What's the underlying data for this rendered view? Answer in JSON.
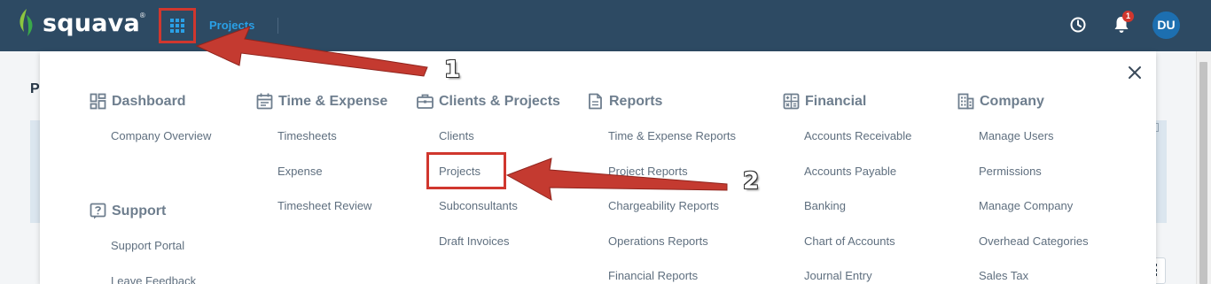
{
  "header": {
    "logo_text": "squava",
    "logo_tm": "®",
    "nav_projects": "Projects",
    "notification_count": "1",
    "avatar_initials": "DU"
  },
  "background": {
    "page_title_initial": "P"
  },
  "menu": {
    "columns": [
      {
        "heading": "Dashboard",
        "icon": "dashboard-icon",
        "items": [
          "Company Overview"
        ]
      },
      {
        "heading": "Time & Expense",
        "icon": "calendar-icon",
        "items": [
          "Timesheets",
          "Expense",
          "Timesheet Review"
        ]
      },
      {
        "heading": "Clients & Projects",
        "icon": "briefcase-icon",
        "items": [
          "Clients",
          "Projects",
          "Subconsultants",
          "Draft Invoices"
        ]
      },
      {
        "heading": "Reports",
        "icon": "report-icon",
        "items": [
          "Time & Expense Reports",
          "Project Reports",
          "Chargeability Reports",
          "Operations Reports",
          "Financial Reports"
        ]
      },
      {
        "heading": "Financial",
        "icon": "calculator-icon",
        "items": [
          "Accounts Receivable",
          "Accounts Payable",
          "Banking",
          "Chart of Accounts",
          "Journal Entry"
        ]
      },
      {
        "heading": "Company",
        "icon": "building-icon",
        "items": [
          "Manage Users",
          "Permissions",
          "Manage Company",
          "Overhead Categories",
          "Sales Tax"
        ]
      }
    ],
    "support": {
      "heading": "Support",
      "icon": "help-icon",
      "items": [
        "Support Portal",
        "Leave Feedback"
      ]
    }
  },
  "annotations": {
    "step1": "1",
    "step2": "2"
  },
  "colors": {
    "header_bg": "#2d4a63",
    "accent": "#2aa0e6",
    "annotation_red": "#d0372e",
    "menu_text": "#5f6f7f"
  }
}
